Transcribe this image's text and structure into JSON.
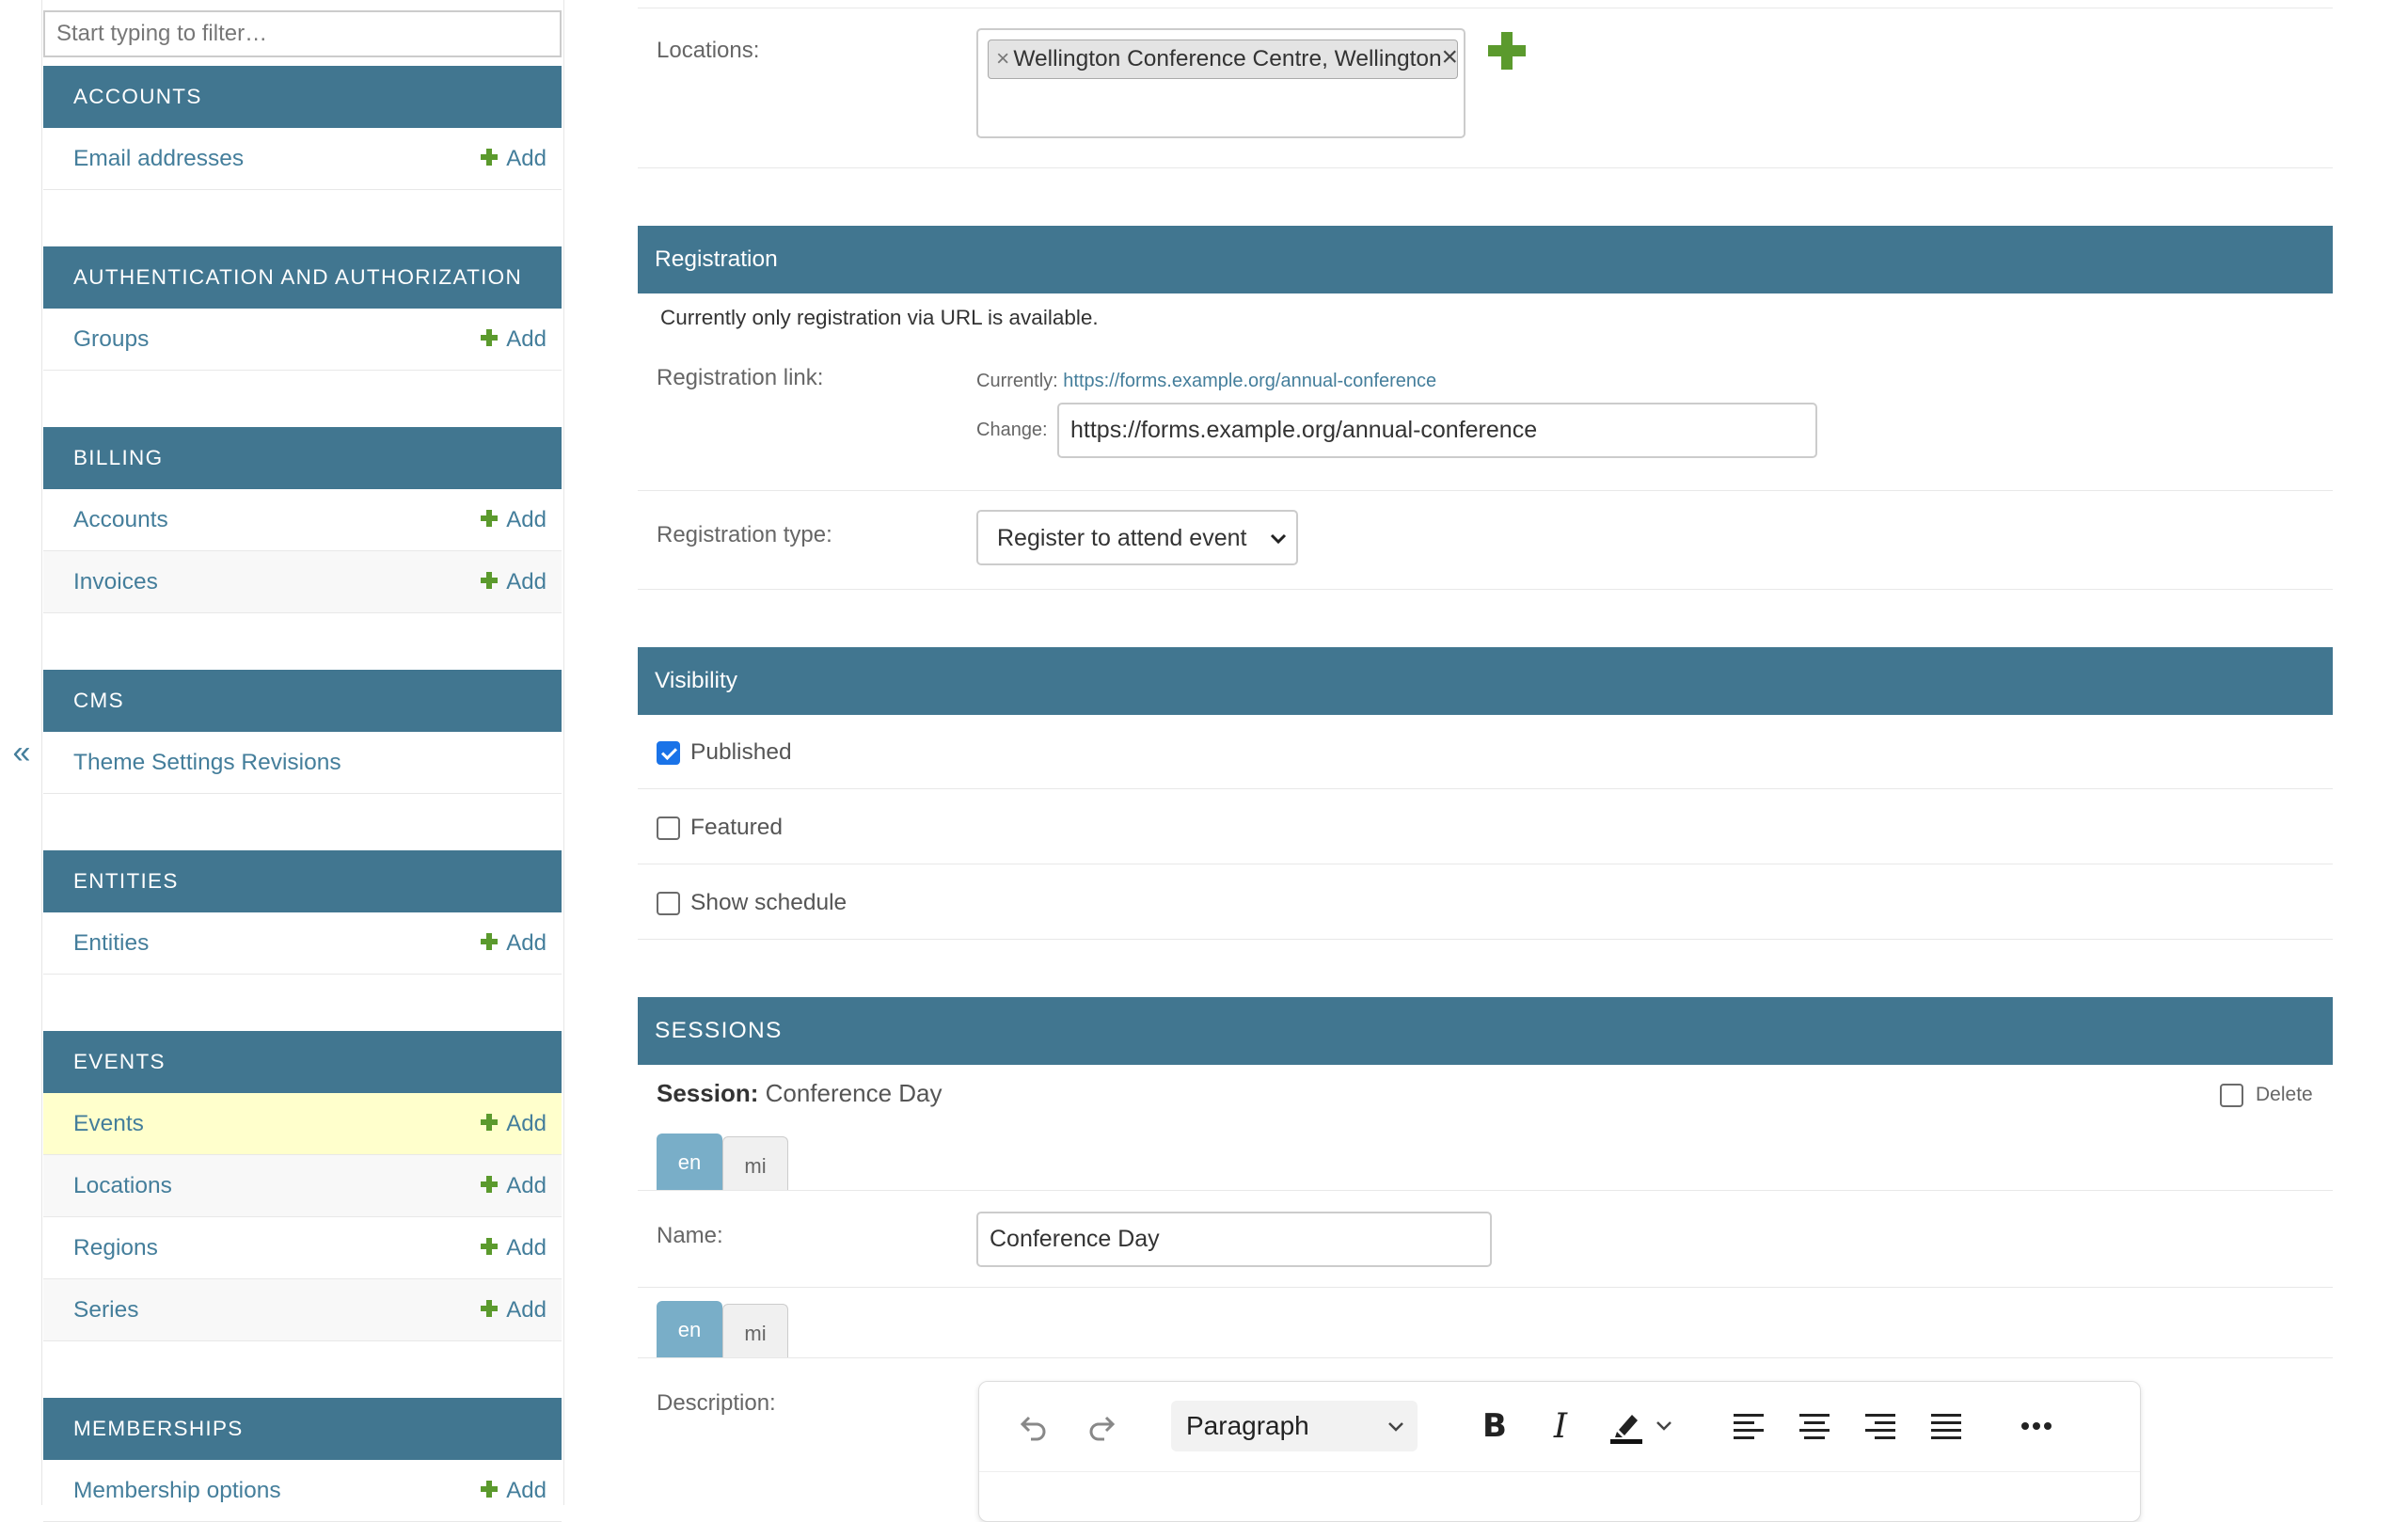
{
  "sidebar": {
    "filter_placeholder": "Start typing to filter…",
    "collapse_glyph": "«",
    "add_label": "Add",
    "modules": [
      {
        "title": "ACCOUNTS",
        "models": [
          {
            "name": "Email addresses",
            "add": true
          }
        ]
      },
      {
        "title": "AUTHENTICATION AND AUTHORIZATION",
        "models": [
          {
            "name": "Groups",
            "add": true
          }
        ]
      },
      {
        "title": "BILLING",
        "models": [
          {
            "name": "Accounts",
            "add": true
          },
          {
            "name": "Invoices",
            "add": true
          }
        ]
      },
      {
        "title": "CMS",
        "models": [
          {
            "name": "Theme Settings Revisions",
            "add": false
          }
        ]
      },
      {
        "title": "ENTITIES",
        "models": [
          {
            "name": "Entities",
            "add": true
          }
        ]
      },
      {
        "title": "EVENTS",
        "models": [
          {
            "name": "Events",
            "add": true,
            "current": true
          },
          {
            "name": "Locations",
            "add": true
          },
          {
            "name": "Regions",
            "add": true
          },
          {
            "name": "Series",
            "add": true
          }
        ]
      },
      {
        "title": "MEMBERSHIPS",
        "models": [
          {
            "name": "Membership options",
            "add": true
          }
        ]
      }
    ]
  },
  "locations": {
    "label": "Locations:",
    "selected": [
      "Wellington Conference Centre, Wellington"
    ],
    "remove_glyph": "×",
    "clear_glyph": "×"
  },
  "registration": {
    "heading": "Registration",
    "description": "Currently only registration via URL is available.",
    "link_label": "Registration link:",
    "currently_label": "Currently:",
    "current_url": "https://forms.example.org/annual-conference",
    "change_label": "Change:",
    "change_value": "https://forms.example.org/annual-conference",
    "type_label": "Registration type:",
    "type_value": "Register to attend event"
  },
  "visibility": {
    "heading": "Visibility",
    "checkboxes": [
      {
        "label": "Published",
        "checked": true
      },
      {
        "label": "Featured",
        "checked": false
      },
      {
        "label": "Show schedule",
        "checked": false
      }
    ]
  },
  "sessions": {
    "heading": "SESSIONS",
    "session_label": "Session:",
    "session_name": "Conference Day",
    "delete_label": "Delete",
    "lang_tabs": [
      "en",
      "mi"
    ],
    "name_label": "Name:",
    "name_value": "Conference Day",
    "description_label": "Description:",
    "paragraph_style": "Paragraph"
  },
  "colors": {
    "header": "#417690",
    "link": "#447e9b",
    "add_plus": "#5b9a2d",
    "current_row": "#ffffcc",
    "active_tab": "#79aec8"
  }
}
